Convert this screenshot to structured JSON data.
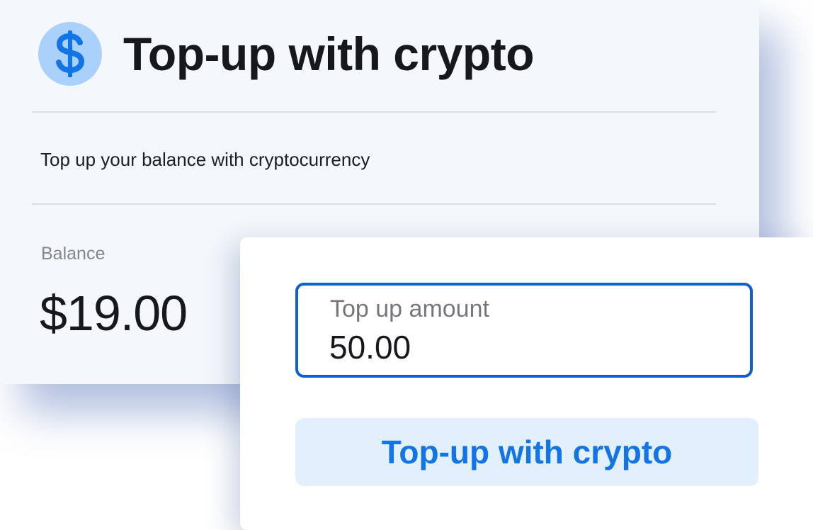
{
  "header": {
    "title": "Top-up with crypto",
    "icon": "dollar-coin-icon"
  },
  "subtitle": "Top up your balance with cryptocurrency",
  "balance": {
    "label": "Balance",
    "value": "$19.00"
  },
  "topup_form": {
    "amount_label": "Top up amount",
    "amount_value": "50.00",
    "button_label": "Top-up with crypto"
  },
  "colors": {
    "accent": "#1274e6",
    "field_border": "#0d5fd6",
    "button_bg": "#e2f0fd",
    "coin_bg": "#a9d1fb",
    "coin_glyph": "#1274e6",
    "card_bg": "#f4f7fb"
  }
}
